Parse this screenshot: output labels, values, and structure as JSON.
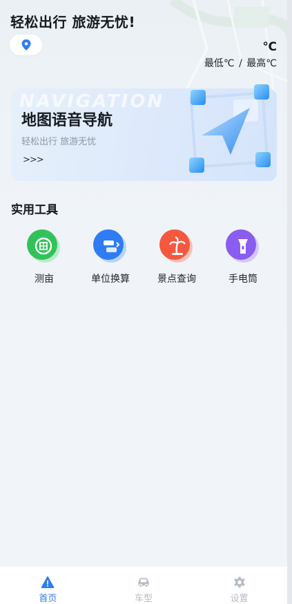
{
  "header": {
    "headline": "轻松出行 旅游无忧!",
    "temperature": "℃",
    "temp_min_label": "最低℃",
    "temp_separator": "/",
    "temp_max_label": "最高℃"
  },
  "nav_card": {
    "watermark": "NAVIGATION",
    "title": "地图语音导航",
    "subtitle": "轻松出行 旅游无忧",
    "arrow": ">>>"
  },
  "tools_section": {
    "title": "实用工具",
    "items": [
      {
        "label": "测亩",
        "icon": "field-measure-icon",
        "color": "#2fbf55"
      },
      {
        "label": "单位换算",
        "icon": "unit-convert-icon",
        "color": "#2f7cf4"
      },
      {
        "label": "景点查询",
        "icon": "palm-tree-icon",
        "color": "#f5583f"
      },
      {
        "label": "手电筒",
        "icon": "flashlight-icon",
        "color": "#8a5cf0"
      }
    ]
  },
  "bottom_nav": {
    "tabs": [
      {
        "label": "首页",
        "icon": "home-alert-icon",
        "active": true
      },
      {
        "label": "车型",
        "icon": "car-icon",
        "active": false
      },
      {
        "label": "设置",
        "icon": "gear-icon",
        "active": false
      }
    ],
    "active_color": "#2f7cf4",
    "inactive_color": "#b6bcc6"
  }
}
